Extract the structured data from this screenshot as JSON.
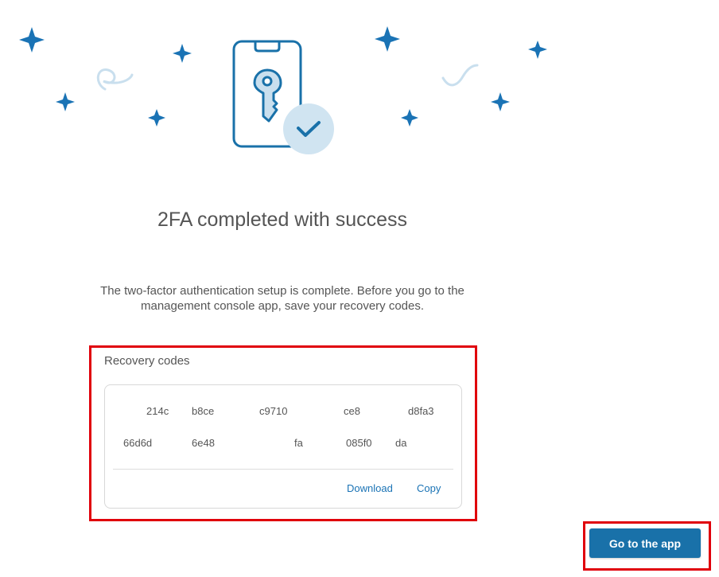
{
  "main": {
    "title": "2FA completed with success",
    "description": "The two-factor authentication setup is complete. Before you go to the management console app, save your recovery codes."
  },
  "recovery": {
    "title": "Recovery codes",
    "codes_row1": [
      "214c",
      "b8ce",
      "c9710",
      "ce8",
      "d8fa3"
    ],
    "codes_row2": [
      "66d6d",
      "6e48",
      "fa",
      "085f0",
      "da"
    ],
    "download_label": "Download",
    "copy_label": "Copy"
  },
  "footer": {
    "go_label": "Go to the app"
  },
  "colors": {
    "accent": "#1971a9",
    "star": "#1a73b5",
    "highlight": "#e0000b"
  }
}
